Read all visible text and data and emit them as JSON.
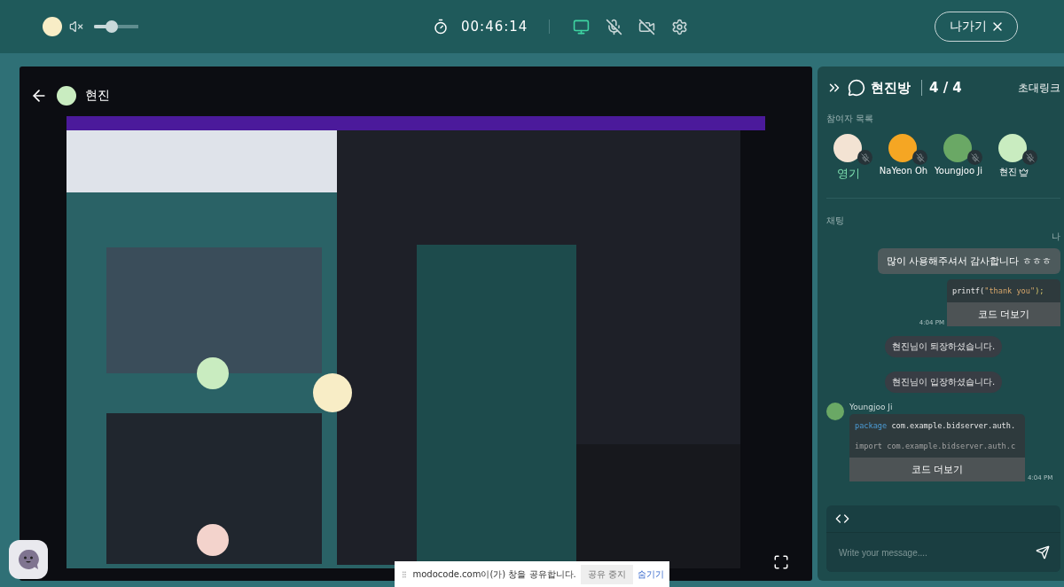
{
  "topbar": {
    "muted": true,
    "volume": {
      "level": 0.4
    },
    "timer": "00:46:14",
    "controls": [
      {
        "kind": "screen",
        "on": true
      },
      {
        "kind": "mic",
        "on": false
      },
      {
        "kind": "camera",
        "on": false
      },
      {
        "kind": "settings"
      }
    ],
    "exit": {
      "label": "나가기"
    }
  },
  "stage": {
    "user": "현진"
  },
  "panel": {
    "room": "현진방",
    "count": "4 / 4",
    "invite": "초대링크",
    "participants_label": "참여자 목록",
    "participants": [
      {
        "name": "영기",
        "color": "#f3e3d3",
        "me": true,
        "host": false,
        "mic_on": false
      },
      {
        "name": "NaYeon Oh",
        "color": "#f5a623",
        "me": false,
        "host": false,
        "mic_on": false
      },
      {
        "name": "Youngjoo Ji",
        "color": "#6aa865",
        "me": false,
        "host": false,
        "mic_on": false
      },
      {
        "name": "현진",
        "color": "#c9ecc0",
        "me": false,
        "host": true,
        "mic_on": false
      }
    ],
    "chat_label": "채팅",
    "messages": [
      {
        "kind": "text",
        "mine": true,
        "author": "나",
        "text": "많이 사용해주셔서 감사합니다 ㅎㅎㅎ"
      },
      {
        "kind": "code",
        "mine": true,
        "lines": [
          [
            {
              "t": "printf(",
              "kind": "plain"
            },
            {
              "t": "\"thank you\"",
              "kind": "string"
            },
            {
              "t": ");",
              "kind": "punct"
            }
          ]
        ],
        "more": "코드 더보기",
        "time": "4:04 PM"
      },
      {
        "kind": "system",
        "text": "현진님이 퇴장하셨습니다."
      },
      {
        "kind": "system",
        "text": "현진님이 입장하셨습니다."
      },
      {
        "kind": "code",
        "mine": false,
        "author": "Youngjoo Ji",
        "color": "#6aa865",
        "lines": [
          [
            {
              "t": "package",
              "kind": "keyword"
            },
            {
              "t": " com.example.bidserver.auth.",
              "kind": "plain"
            }
          ],
          [
            {
              "t": "import com.example.bidserver.auth.c",
              "kind": "comment"
            }
          ]
        ],
        "more": "코드 더보기",
        "time": "4:04 PM"
      }
    ],
    "composer": {
      "placeholder": "Write your message...."
    }
  },
  "share_bar": {
    "text": "modocode.com이(가) 창을 공유합니다.",
    "stop": "공유 중지",
    "hide": "숨기기"
  }
}
